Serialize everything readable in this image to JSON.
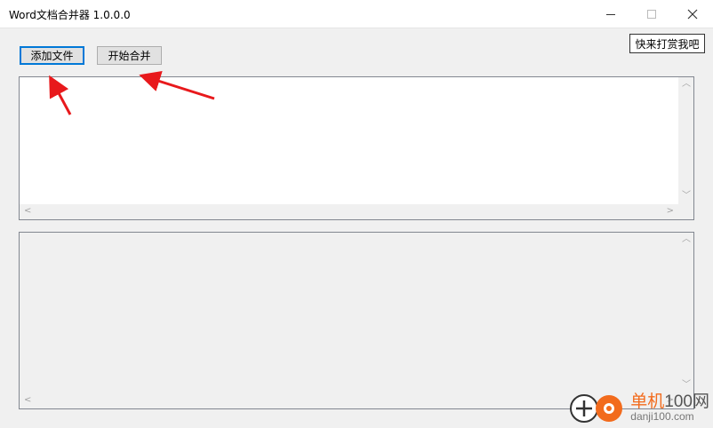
{
  "window": {
    "title": "Word文档合并器 1.0.0.0"
  },
  "toolbar": {
    "add_files_label": "添加文件",
    "start_merge_label": "开始合并",
    "reward_label": "快来打赏我吧"
  },
  "watermark": {
    "line1_cn": "单机",
    "line1_num": "100网",
    "line2": "danji100.com"
  },
  "colors": {
    "accent": "#0078d7",
    "annotation_arrow": "#e8191c",
    "watermark_orange": "#f26b1d"
  }
}
